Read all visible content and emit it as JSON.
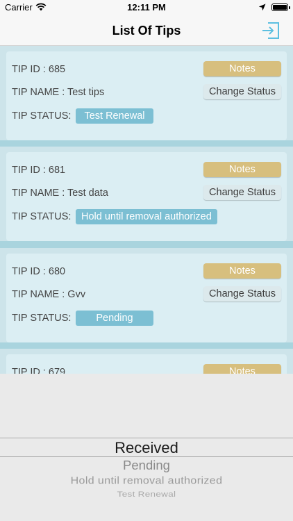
{
  "status_bar": {
    "carrier": "Carrier",
    "time": "12:11 PM"
  },
  "nav": {
    "title": "List Of Tips",
    "logout_icon": "logout-icon"
  },
  "colors": {
    "notes_button": "#d7bf7e",
    "status_badge": "#7cbfd3",
    "list_background": "#a9d4de",
    "card": "#dbeef3",
    "logout_icon": "#5cbfe0"
  },
  "tips": [
    {
      "id_text": "TIP ID : 685",
      "name_text": "TIP NAME : Test tips",
      "status_label": "TIP STATUS:",
      "status": "Test Renewal",
      "notes_label": "Notes",
      "change_label": "Change Status"
    },
    {
      "id_text": "TIP ID : 681",
      "name_text": "TIP NAME : Test data",
      "status_label": "TIP STATUS:",
      "status": "Hold until removal authorized",
      "notes_label": "Notes",
      "change_label": "Change Status"
    },
    {
      "id_text": "TIP ID : 680",
      "name_text": "TIP NAME : Gvv",
      "status_label": "TIP STATUS:",
      "status": "Pending",
      "notes_label": "Notes",
      "change_label": "Change Status"
    },
    {
      "id_text": "TIP ID : 679",
      "notes_label": "Notes"
    }
  ],
  "picker": {
    "options": [
      "Received",
      "Pending",
      "Hold until removal authorized",
      "Test Renewal"
    ],
    "selected": "Received"
  }
}
